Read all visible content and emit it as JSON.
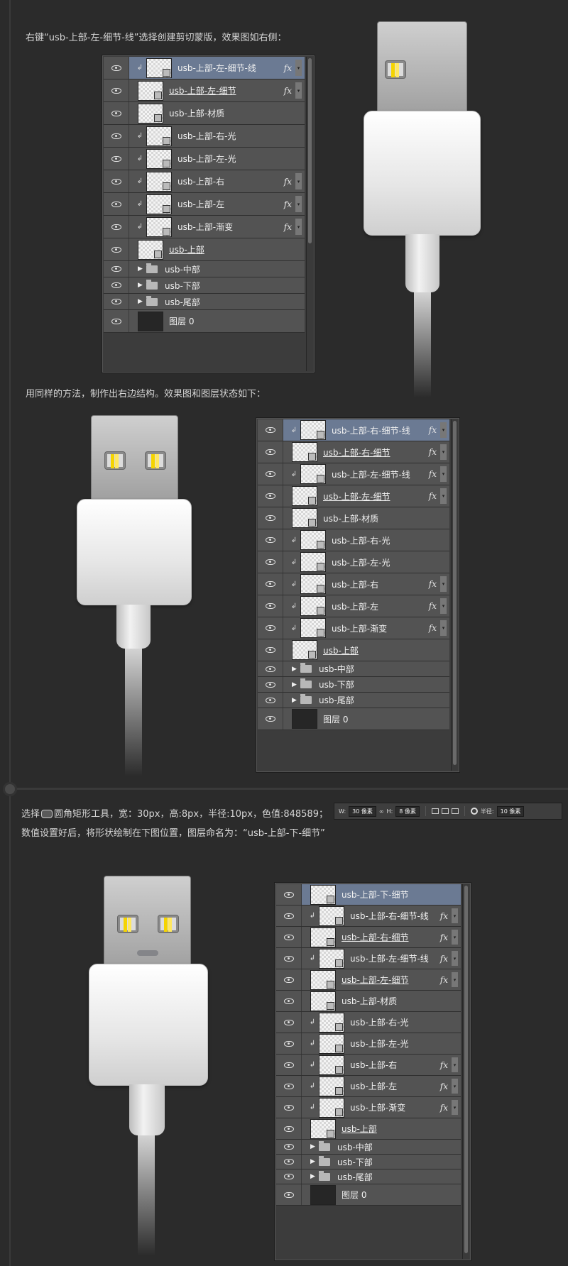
{
  "captions": {
    "step1": "右键“usb-上部-左-细节-线”选择创建剪切蒙版，效果图如右侧：",
    "step2": "用同样的方法，制作出右边结构。效果图和图层状态如下：",
    "step3_pre": "选择",
    "step3_post": "圆角矩形工具，宽：30px，高:8px，半径:10px，色值:848589；",
    "step4": "数值设置好后，将形状绘制在下图位置，图层命名为：“usb-上部-下-细节”"
  },
  "panel1": [
    {
      "name": "usb-上部-左-细节-线",
      "clip": true,
      "fx": true,
      "selected": true,
      "underline": false
    },
    {
      "name": "usb-上部-左-细节",
      "clip": false,
      "fx": true,
      "underline": true
    },
    {
      "name": "usb-上部-材质",
      "clip": false,
      "fx": false
    },
    {
      "name": "usb-上部-右-光",
      "clip": true,
      "fx": false
    },
    {
      "name": "usb-上部-左-光",
      "clip": true,
      "fx": false
    },
    {
      "name": "usb-上部-右",
      "clip": true,
      "fx": true
    },
    {
      "name": "usb-上部-左",
      "clip": true,
      "fx": true
    },
    {
      "name": "usb-上部-渐变",
      "clip": true,
      "fx": true
    },
    {
      "name": "usb-上部",
      "clip": false,
      "fx": false,
      "underline": true
    },
    {
      "name": "usb-中部",
      "group": true
    },
    {
      "name": "usb-下部",
      "group": true
    },
    {
      "name": "usb-尾部",
      "group": true
    },
    {
      "name": "图层 0",
      "dark": true
    }
  ],
  "panel2": [
    {
      "name": "usb-上部-右-细节-线",
      "clip": true,
      "fx": true,
      "selected": true
    },
    {
      "name": "usb-上部-右-细节",
      "fx": true,
      "underline": true
    },
    {
      "name": "usb-上部-左-细节-线",
      "clip": true,
      "fx": true
    },
    {
      "name": "usb-上部-左-细节",
      "fx": true,
      "underline": true
    },
    {
      "name": "usb-上部-材质"
    },
    {
      "name": "usb-上部-右-光",
      "clip": true
    },
    {
      "name": "usb-上部-左-光",
      "clip": true
    },
    {
      "name": "usb-上部-右",
      "clip": true,
      "fx": true
    },
    {
      "name": "usb-上部-左",
      "clip": true,
      "fx": true
    },
    {
      "name": "usb-上部-渐变",
      "clip": true,
      "fx": true
    },
    {
      "name": "usb-上部",
      "underline": true
    },
    {
      "name": "usb-中部",
      "group": true
    },
    {
      "name": "usb-下部",
      "group": true
    },
    {
      "name": "usb-尾部",
      "group": true
    },
    {
      "name": "图层 0",
      "dark": true
    }
  ],
  "panel3": [
    {
      "name": "usb-上部-下-细节",
      "selected": true
    },
    {
      "name": "usb-上部-右-细节-线",
      "clip": true,
      "fx": true
    },
    {
      "name": "usb-上部-右-细节",
      "fx": true,
      "underline": true
    },
    {
      "name": "usb-上部-左-细节-线",
      "clip": true,
      "fx": true
    },
    {
      "name": "usb-上部-左-细节",
      "fx": true,
      "underline": true
    },
    {
      "name": "usb-上部-材质"
    },
    {
      "name": "usb-上部-右-光",
      "clip": true
    },
    {
      "name": "usb-上部-左-光",
      "clip": true
    },
    {
      "name": "usb-上部-右",
      "clip": true,
      "fx": true
    },
    {
      "name": "usb-上部-左",
      "clip": true,
      "fx": true
    },
    {
      "name": "usb-上部-渐变",
      "clip": true,
      "fx": true
    },
    {
      "name": "usb-上部",
      "underline": true
    },
    {
      "name": "usb-中部",
      "group": true
    },
    {
      "name": "usb-下部",
      "group": true
    },
    {
      "name": "usb-尾部",
      "group": true
    },
    {
      "name": "图层 0",
      "dark": true
    }
  ],
  "fx_label": "fx",
  "toolbar": {
    "w_label": "W:",
    "w_value": "30 像素",
    "link": "∞",
    "h_label": "H:",
    "h_value": "8 像素",
    "radius_label": "半径:",
    "radius_value": "10 像素"
  },
  "colors": {
    "background": "#2b2b2b",
    "shape_fill": "#848589",
    "selected_layer": "#6b7a93"
  }
}
